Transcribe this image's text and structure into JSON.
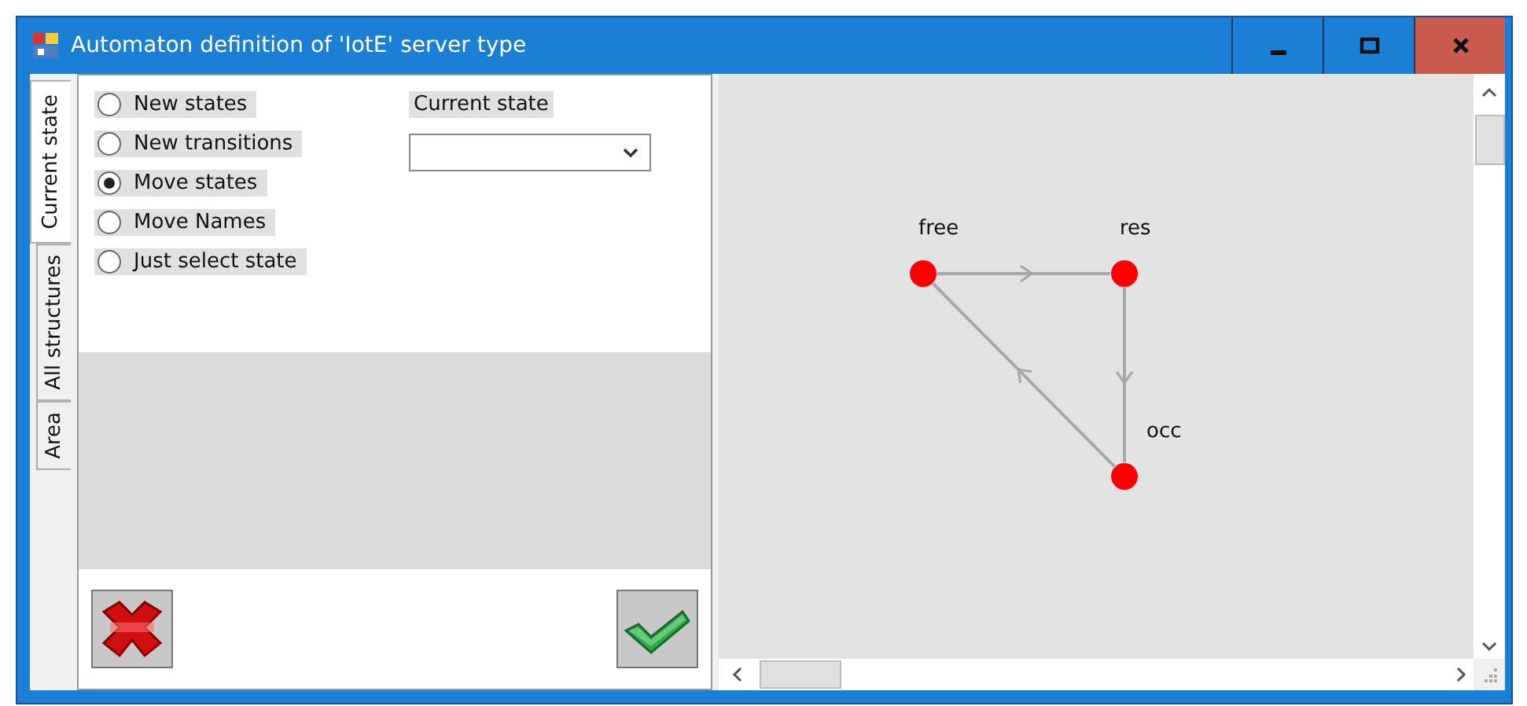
{
  "window": {
    "title": "Automaton definition of 'IotE' server type"
  },
  "side_tabs": [
    {
      "label": "Current state",
      "selected": true
    },
    {
      "label": "All structures",
      "selected": false
    },
    {
      "label": "Area",
      "selected": false
    }
  ],
  "modes": [
    {
      "label": "New states",
      "selected": false
    },
    {
      "label": "New transitions",
      "selected": false
    },
    {
      "label": "Move states",
      "selected": true
    },
    {
      "label": "Move Names",
      "selected": false
    },
    {
      "label": "Just select state",
      "selected": false
    }
  ],
  "current_state": {
    "label": "Current state"
  },
  "graph": {
    "states": [
      {
        "name": "free"
      },
      {
        "name": "res"
      },
      {
        "name": "occ"
      }
    ]
  }
}
